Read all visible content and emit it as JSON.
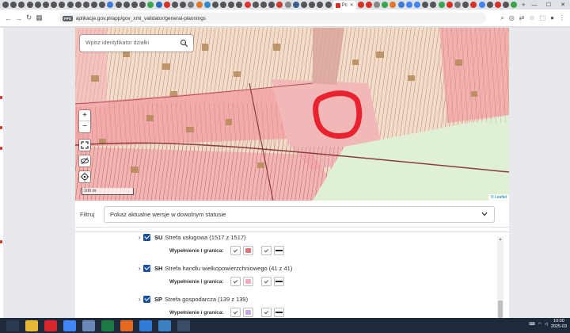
{
  "browser": {
    "active_tab": {
      "title": "Pc",
      "close": "✕"
    },
    "new_tab": "+",
    "tab_colors": [
      "#555",
      "#555",
      "#555",
      "#555",
      "#555",
      "#555",
      "#555",
      "#555",
      "#555",
      "#555",
      "#555",
      "#555",
      "#555",
      "#3f7dd8",
      "#555",
      "#555",
      "#555",
      "#555",
      "#3aa54a",
      "#2c6fbe",
      "#d93025",
      "#555",
      "#555",
      "#777",
      "#e0772b",
      "#2f8ac7",
      "#555",
      "#555",
      "#555",
      "#555",
      "#d33",
      "#555",
      "#555",
      "#555",
      "#cc3b2b",
      "#888",
      "#3c5f8a",
      "#555",
      "#555",
      "#555",
      "#555"
    ],
    "tab_colors_right": [
      "#d93025",
      "#d93025",
      "#888",
      "#3aa54a",
      "#e0772b",
      "#3f7dd8",
      "#4285f4",
      "#4285f4",
      "#555",
      "#555",
      "#3aa54a",
      "#d93025",
      "#777",
      "#555",
      "#d93025",
      "#4285f4",
      "#555",
      "#d93025",
      "#555",
      "#3aa54a"
    ],
    "window_controls": [
      "—",
      "☐",
      "✕"
    ],
    "url_badge": "FPS",
    "url": "aplikacje.gov.pl/app/gov_xml_validator/general-plannings"
  },
  "map": {
    "search_placeholder": "Wpisz identyfikator działki",
    "zoom_in": "+",
    "zoom_out": "−",
    "scale_label": "100 m",
    "attribution": "© Leaflet",
    "colors": {
      "base": "#f3ddc8",
      "residential": "#f3a3a6",
      "service": "#f2b8b8",
      "green": "#dff0d4",
      "highlight": "#e8232f"
    }
  },
  "filter": {
    "label": "Filtruj",
    "selected": "Pokaż aktualne wersje w dowolnym statusie"
  },
  "legend": {
    "items": [
      {
        "code": "SU",
        "name": "Strefa usługowa (1517 z 1517)",
        "fill_color": "#e4737a"
      },
      {
        "code": "SH",
        "name": "Strefa handlu wielkopowierzchniowego (41 z 41)",
        "fill_color": "#f4a9c4"
      },
      {
        "code": "SP",
        "name": "Strefa gospodarcza (139 z 139)",
        "fill_color": "#c8a9e6"
      }
    ],
    "sub_label": "Wypełnienie i granica:"
  },
  "taskbar": {
    "apps": [
      {
        "name": "windows-start",
        "color": "#2a3a4f"
      },
      {
        "name": "file-explorer",
        "color": "#e8b838"
      },
      {
        "name": "opera",
        "color": "#d8262f"
      },
      {
        "name": "chrome",
        "color": "#4285f4"
      },
      {
        "name": "notepad",
        "color": "#6a89b8"
      },
      {
        "name": "excel",
        "color": "#1d7a44"
      },
      {
        "name": "firefox",
        "color": "#e66a1f"
      },
      {
        "name": "app-blue",
        "color": "#2f7bd8"
      },
      {
        "name": "app-phi",
        "color": "#3a82c4"
      },
      {
        "name": "app-dark",
        "color": "#3b4c66"
      }
    ],
    "time": "10:00",
    "date": "2025-03"
  }
}
